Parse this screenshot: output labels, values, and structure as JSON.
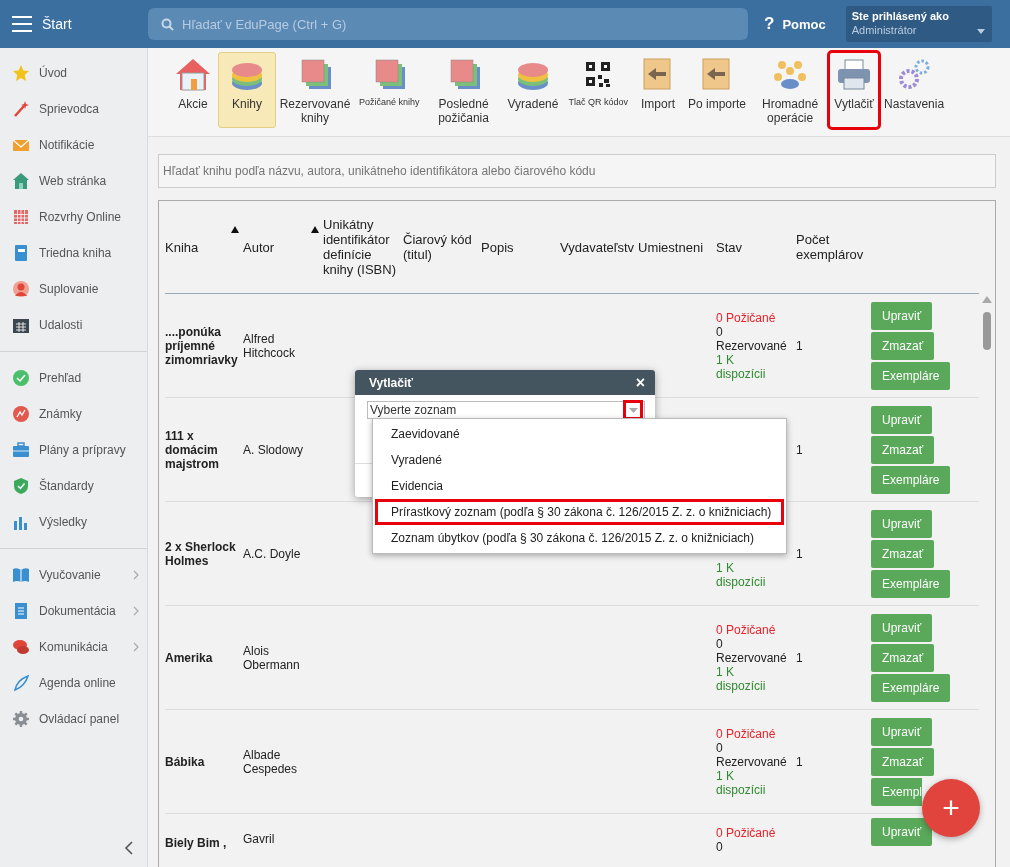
{
  "top_bar": {
    "title": "Štart",
    "search": {
      "placeholder": "Hľadať v EduPage (Ctrl + G)"
    },
    "help_icon": "?",
    "help": "Pomoc",
    "user": {
      "caption": "Ste prihlásený ako",
      "name": "Administrátor"
    }
  },
  "sidebar": {
    "groups": [
      [
        {
          "label": "Úvod",
          "submenu": false
        },
        {
          "label": "Sprievodca",
          "submenu": false
        },
        {
          "label": "Notifikácie",
          "submenu": false
        },
        {
          "label": "Web stránka",
          "submenu": false
        },
        {
          "label": "Rozvrhy Online",
          "submenu": false
        },
        {
          "label": "Triedna kniha",
          "submenu": false
        },
        {
          "label": "Suplovanie",
          "submenu": false
        },
        {
          "label": "Udalosti",
          "submenu": false
        }
      ],
      [
        {
          "label": "Prehľad",
          "submenu": false
        },
        {
          "label": "Známky",
          "submenu": false
        },
        {
          "label": "Plány a prípravy",
          "submenu": false
        },
        {
          "label": "Štandardy",
          "submenu": false
        },
        {
          "label": "Výsledky",
          "submenu": false
        }
      ],
      [
        {
          "label": "Vyučovanie",
          "submenu": true
        },
        {
          "label": "Dokumentácia",
          "submenu": true
        },
        {
          "label": "Komunikácia",
          "submenu": true
        },
        {
          "label": "Agenda online",
          "submenu": false
        },
        {
          "label": "Ovládací panel",
          "submenu": false
        }
      ]
    ]
  },
  "toolbar": [
    {
      "label": "Akcie",
      "selected": false,
      "highlighted": false,
      "small": false
    },
    {
      "label": "Knihy",
      "selected": true,
      "highlighted": false,
      "small": false
    },
    {
      "label": "Rezervované knihy",
      "selected": false,
      "highlighted": false,
      "small": false
    },
    {
      "label": "Požičané knihy",
      "selected": false,
      "highlighted": false,
      "small": true
    },
    {
      "label": "Posledné požičania",
      "selected": false,
      "highlighted": false,
      "small": false
    },
    {
      "label": "Vyradené",
      "selected": false,
      "highlighted": false,
      "small": false
    },
    {
      "label": "Tlač QR kódov",
      "selected": false,
      "highlighted": false,
      "small": true
    },
    {
      "label": "Import",
      "selected": false,
      "highlighted": false,
      "small": false
    },
    {
      "label": "Po importe",
      "selected": false,
      "highlighted": false,
      "small": false
    },
    {
      "label": "Hromadné operácie",
      "selected": false,
      "highlighted": false,
      "small": false
    },
    {
      "label": "Vytlačiť",
      "selected": false,
      "highlighted": true,
      "small": false
    },
    {
      "label": "Nastavenia",
      "selected": false,
      "highlighted": false,
      "small": false
    }
  ],
  "book_search": {
    "placeholder": "Hľadať knihu podľa názvu, autora, unikátneho identifikátora alebo čiarového kódu"
  },
  "table": {
    "columns": [
      {
        "label": "Kniha",
        "sort": true
      },
      {
        "label": "Autor",
        "sort": true
      },
      {
        "label": "Unikátny identifikátor definície knihy (ISBN)",
        "sort": false
      },
      {
        "label": "Čiarový kód (titul)",
        "sort": false
      },
      {
        "label": "Popis",
        "sort": false
      },
      {
        "label": "Vydavateľstv",
        "sort": false
      },
      {
        "label": "Umiestneni",
        "sort": false
      },
      {
        "label": "Stav",
        "sort": false
      },
      {
        "label": "Počet exemplárov",
        "sort": false
      }
    ],
    "rows": [
      {
        "title": "....ponúka príjemné zimomriavky",
        "author": "Alfred Hitchcock",
        "status": [
          {
            "kind": "borrowed",
            "text": "0 Požičané"
          },
          {
            "kind": "reserved",
            "text": "0 Rezervované"
          },
          {
            "kind": "available",
            "text": "1 K dispozícii"
          }
        ],
        "count": "1",
        "actions": [
          "Upraviť",
          "Zmazať",
          "Exempláre"
        ]
      },
      {
        "title": "111 x domácim majstrom",
        "author": "A. Slodowy",
        "status": [],
        "count": "1",
        "actions": [
          "Upraviť",
          "Zmazať",
          "Exempláre"
        ]
      },
      {
        "title": "2 x Sherlock Holmes",
        "author": "A.C. Doyle",
        "status": [
          {
            "kind": "available",
            "text": "1 K dispozícii"
          }
        ],
        "count": "1",
        "actions": [
          "Upraviť",
          "Zmazať",
          "Exempláre"
        ]
      },
      {
        "title": "Amerika",
        "author": "Alois Obermann",
        "status": [
          {
            "kind": "borrowed",
            "text": "0 Požičané"
          },
          {
            "kind": "reserved",
            "text": "0 Rezervované"
          },
          {
            "kind": "available",
            "text": "1 K dispozícii"
          }
        ],
        "count": "1",
        "actions": [
          "Upraviť",
          "Zmazať",
          "Exempláre"
        ]
      },
      {
        "title": "Bábika",
        "author": "Albade Cespedes",
        "status": [
          {
            "kind": "borrowed",
            "text": "0 Požičané"
          },
          {
            "kind": "reserved",
            "text": "0 Rezervované"
          },
          {
            "kind": "available",
            "text": "1 K dispozícii"
          }
        ],
        "count": "1",
        "actions": [
          "Upraviť",
          "Zmazať",
          "Exempl"
        ]
      },
      {
        "title": "Biely Bim ,",
        "author": "Gavril",
        "status": [
          {
            "kind": "borrowed",
            "text": "0 Požičané"
          },
          {
            "kind": "reserved",
            "text": "0"
          }
        ],
        "actions": [
          "Upraviť"
        ]
      }
    ]
  },
  "dialog": {
    "title": "Vytlačiť",
    "close": "×",
    "select": {
      "value": "Vyberte zoznam",
      "arrow_highlighted": true
    },
    "options": [
      {
        "label": "Zaevidované",
        "highlighted": false
      },
      {
        "label": "Vyradené",
        "highlighted": false
      },
      {
        "label": "Evidencia",
        "highlighted": false
      },
      {
        "label": "Prírastkový zoznam (podľa § 30 zákona č. 126/2015 Z. z. o knižniciach)",
        "highlighted": true
      },
      {
        "label": "Zoznam úbytkov (podľa § 30 zákona č. 126/2015 Z. z. o knižniciach)",
        "highlighted": false
      }
    ]
  },
  "fab": "+"
}
